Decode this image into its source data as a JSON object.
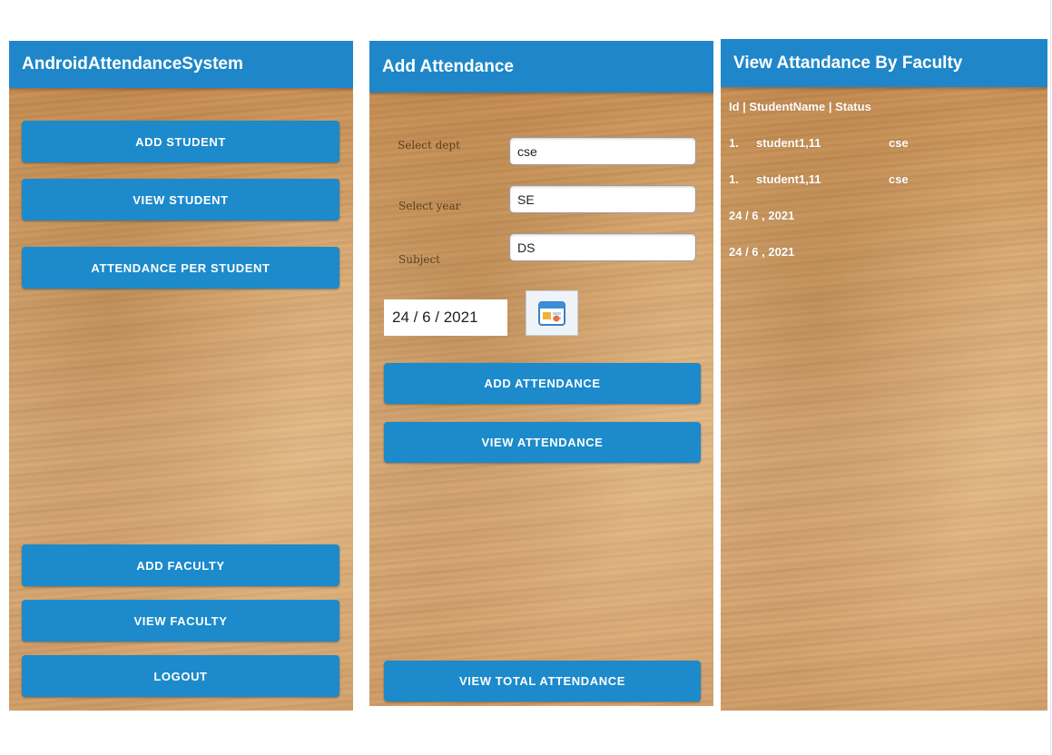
{
  "home": {
    "title": "AndroidAttendanceSystem",
    "buttons": {
      "add_student": "ADD STUDENT",
      "view_student": "VIEW STUDENT",
      "attendance_per_student": "ATTENDANCE PER STUDENT",
      "add_faculty": "ADD FACULTY",
      "view_faculty": "VIEW FACULTY",
      "logout": "LOGOUT"
    }
  },
  "add_attendance": {
    "title": "Add Attendance",
    "labels": {
      "dept": "Select dept",
      "year": "Select year",
      "subject": "Subject"
    },
    "values": {
      "dept": "cse",
      "year": "SE",
      "subject": "DS"
    },
    "date": "24 / 6 / 2021",
    "calendar_icon": "calendar-icon",
    "buttons": {
      "add_attendance": "ADD ATTENDANCE",
      "view_attendance": "VIEW ATTENDANCE",
      "view_total_attendance": "VIEW TOTAL ATTENDANCE"
    }
  },
  "view_attendance": {
    "title": "View Attandance By Faculty",
    "header": "Id | StudentName |  Status",
    "rows": [
      {
        "id": "1.",
        "name": "student1,11",
        "status": "cse"
      },
      {
        "id": "1.",
        "name": "student1,11",
        "status": "cse"
      }
    ],
    "dates": [
      "24 / 6 , 2021",
      "24 / 6 , 2021"
    ]
  },
  "colors": {
    "primary": "#1f87c9",
    "button": "#1c8acb",
    "wood": "#d6a56c"
  }
}
